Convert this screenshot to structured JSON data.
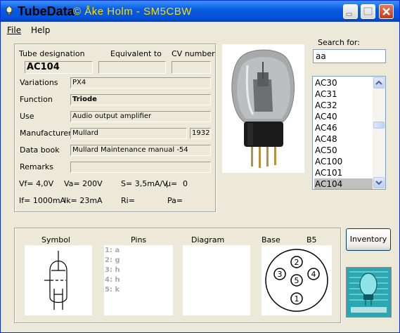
{
  "window": {
    "app_title": "TubeData",
    "author_watermark": "© Åke Holm - SM5CBW"
  },
  "menu": {
    "file": "File",
    "help": "Help"
  },
  "labels": {
    "tube_designation": "Tube designation",
    "equivalent_to": "Equivalent to",
    "cv_number": "CV number",
    "variations": "Variations",
    "function": "Function",
    "use": "Use",
    "manufacturer": "Manufacturer",
    "data_book": "Data book",
    "remarks": "Remarks"
  },
  "tube": {
    "designation": "AC104",
    "equivalent": "",
    "cv_number": "",
    "variations": "PX4",
    "function": "Triode",
    "use": "Audio output amplifier",
    "manufacturer": "Mullard",
    "year": "1932",
    "data_book": "Mullard Maintenance manual -54",
    "remarks": ""
  },
  "params": {
    "vf": "Vf= 4,0V",
    "va": "Va= 200V",
    "s": "S= 3,5mA/V",
    "mu": "µ=",
    "mu_value": "0",
    "if": "If= 1000mA",
    "ik": "Ik= 23mA",
    "ri": "Ri=",
    "pa": "Pa="
  },
  "search": {
    "label": "Search for:",
    "value": "aa"
  },
  "tube_list": {
    "items": [
      "AC30",
      "AC31",
      "AC32",
      "AC40",
      "AC46",
      "AC48",
      "AC50",
      "AC100",
      "AC101",
      "AC104"
    ],
    "selected": "AC104"
  },
  "bottom_panel": {
    "symbol_label": "Symbol",
    "pins_label": "Pins",
    "diagram_label": "Diagram",
    "base_label": "Base",
    "base_type": "B5",
    "pins": [
      "1: a",
      "2: g",
      "3: h",
      "4: h",
      "5: k"
    ],
    "base_pin_numbers": [
      "1",
      "2",
      "3",
      "4",
      "5"
    ]
  },
  "buttons": {
    "inventory": "Inventory"
  },
  "colors": {
    "titlebar": "#0a5ce0",
    "watermark": "#f6e000",
    "face": "#ece9d8",
    "selection": "#c0c0c0"
  }
}
